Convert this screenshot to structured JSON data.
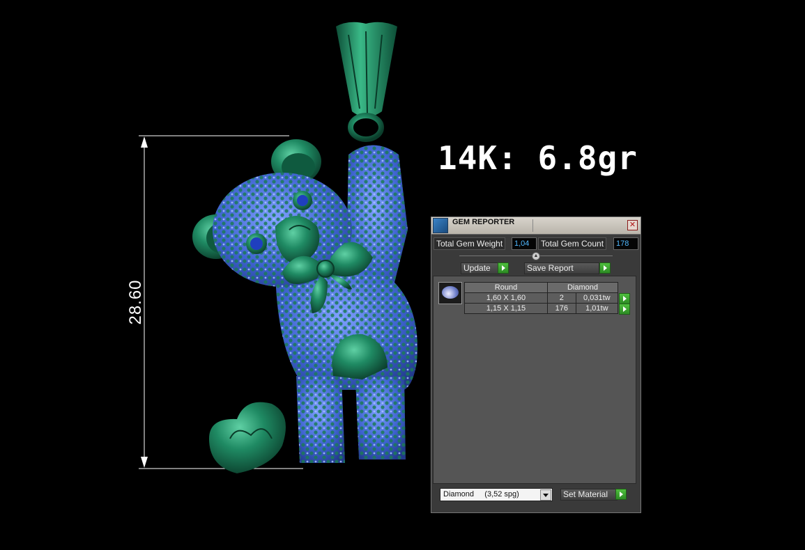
{
  "dimension": {
    "label": "28.60"
  },
  "weight": {
    "label": "14K: 6.8gr"
  },
  "gem_reporter": {
    "title": "GEM REPORTER",
    "total_gem_weight_label": "Total Gem Weight",
    "total_gem_weight_value": "1,04",
    "total_gem_count_label": "Total Gem Count",
    "total_gem_count_value": "178",
    "update_label": "Update",
    "save_report_label": "Save Report",
    "table": {
      "headers": [
        "Round",
        "Diamond"
      ],
      "rows": [
        {
          "size": "1,60 X 1,60",
          "count": "2",
          "weight": "0,031tw"
        },
        {
          "size": "1,15 X 1,15",
          "count": "176",
          "weight": "1,01tw"
        }
      ]
    },
    "material_select": "Diamond     (3,52 spg)",
    "set_material_label": "Set Material"
  },
  "colors": {
    "metal": "#1f8a63",
    "gem_blue": "#4a6fd8",
    "eye_blue": "#1f3fbf",
    "accent_value": "#4fb8ff",
    "go_green": "#3aa82e"
  }
}
